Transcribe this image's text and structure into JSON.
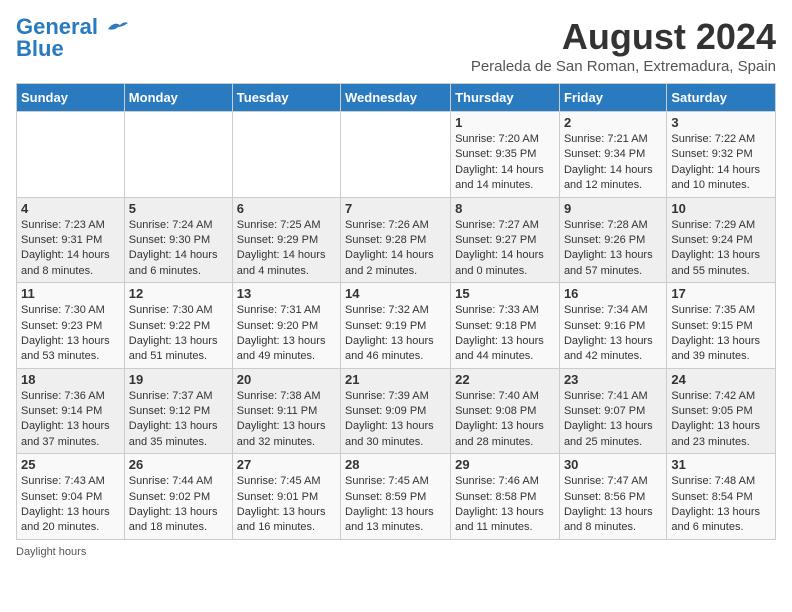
{
  "header": {
    "logo_line1": "General",
    "logo_line2": "Blue",
    "month_year": "August 2024",
    "location": "Peraleda de San Roman, Extremadura, Spain"
  },
  "days_of_week": [
    "Sunday",
    "Monday",
    "Tuesday",
    "Wednesday",
    "Thursday",
    "Friday",
    "Saturday"
  ],
  "weeks": [
    [
      {
        "day": "",
        "info": ""
      },
      {
        "day": "",
        "info": ""
      },
      {
        "day": "",
        "info": ""
      },
      {
        "day": "",
        "info": ""
      },
      {
        "day": "1",
        "info": "Sunrise: 7:20 AM\nSunset: 9:35 PM\nDaylight: 14 hours\nand 14 minutes."
      },
      {
        "day": "2",
        "info": "Sunrise: 7:21 AM\nSunset: 9:34 PM\nDaylight: 14 hours\nand 12 minutes."
      },
      {
        "day": "3",
        "info": "Sunrise: 7:22 AM\nSunset: 9:32 PM\nDaylight: 14 hours\nand 10 minutes."
      }
    ],
    [
      {
        "day": "4",
        "info": "Sunrise: 7:23 AM\nSunset: 9:31 PM\nDaylight: 14 hours\nand 8 minutes."
      },
      {
        "day": "5",
        "info": "Sunrise: 7:24 AM\nSunset: 9:30 PM\nDaylight: 14 hours\nand 6 minutes."
      },
      {
        "day": "6",
        "info": "Sunrise: 7:25 AM\nSunset: 9:29 PM\nDaylight: 14 hours\nand 4 minutes."
      },
      {
        "day": "7",
        "info": "Sunrise: 7:26 AM\nSunset: 9:28 PM\nDaylight: 14 hours\nand 2 minutes."
      },
      {
        "day": "8",
        "info": "Sunrise: 7:27 AM\nSunset: 9:27 PM\nDaylight: 14 hours\nand 0 minutes."
      },
      {
        "day": "9",
        "info": "Sunrise: 7:28 AM\nSunset: 9:26 PM\nDaylight: 13 hours\nand 57 minutes."
      },
      {
        "day": "10",
        "info": "Sunrise: 7:29 AM\nSunset: 9:24 PM\nDaylight: 13 hours\nand 55 minutes."
      }
    ],
    [
      {
        "day": "11",
        "info": "Sunrise: 7:30 AM\nSunset: 9:23 PM\nDaylight: 13 hours\nand 53 minutes."
      },
      {
        "day": "12",
        "info": "Sunrise: 7:30 AM\nSunset: 9:22 PM\nDaylight: 13 hours\nand 51 minutes."
      },
      {
        "day": "13",
        "info": "Sunrise: 7:31 AM\nSunset: 9:20 PM\nDaylight: 13 hours\nand 49 minutes."
      },
      {
        "day": "14",
        "info": "Sunrise: 7:32 AM\nSunset: 9:19 PM\nDaylight: 13 hours\nand 46 minutes."
      },
      {
        "day": "15",
        "info": "Sunrise: 7:33 AM\nSunset: 9:18 PM\nDaylight: 13 hours\nand 44 minutes."
      },
      {
        "day": "16",
        "info": "Sunrise: 7:34 AM\nSunset: 9:16 PM\nDaylight: 13 hours\nand 42 minutes."
      },
      {
        "day": "17",
        "info": "Sunrise: 7:35 AM\nSunset: 9:15 PM\nDaylight: 13 hours\nand 39 minutes."
      }
    ],
    [
      {
        "day": "18",
        "info": "Sunrise: 7:36 AM\nSunset: 9:14 PM\nDaylight: 13 hours\nand 37 minutes."
      },
      {
        "day": "19",
        "info": "Sunrise: 7:37 AM\nSunset: 9:12 PM\nDaylight: 13 hours\nand 35 minutes."
      },
      {
        "day": "20",
        "info": "Sunrise: 7:38 AM\nSunset: 9:11 PM\nDaylight: 13 hours\nand 32 minutes."
      },
      {
        "day": "21",
        "info": "Sunrise: 7:39 AM\nSunset: 9:09 PM\nDaylight: 13 hours\nand 30 minutes."
      },
      {
        "day": "22",
        "info": "Sunrise: 7:40 AM\nSunset: 9:08 PM\nDaylight: 13 hours\nand 28 minutes."
      },
      {
        "day": "23",
        "info": "Sunrise: 7:41 AM\nSunset: 9:07 PM\nDaylight: 13 hours\nand 25 minutes."
      },
      {
        "day": "24",
        "info": "Sunrise: 7:42 AM\nSunset: 9:05 PM\nDaylight: 13 hours\nand 23 minutes."
      }
    ],
    [
      {
        "day": "25",
        "info": "Sunrise: 7:43 AM\nSunset: 9:04 PM\nDaylight: 13 hours\nand 20 minutes."
      },
      {
        "day": "26",
        "info": "Sunrise: 7:44 AM\nSunset: 9:02 PM\nDaylight: 13 hours\nand 18 minutes."
      },
      {
        "day": "27",
        "info": "Sunrise: 7:45 AM\nSunset: 9:01 PM\nDaylight: 13 hours\nand 16 minutes."
      },
      {
        "day": "28",
        "info": "Sunrise: 7:45 AM\nSunset: 8:59 PM\nDaylight: 13 hours\nand 13 minutes."
      },
      {
        "day": "29",
        "info": "Sunrise: 7:46 AM\nSunset: 8:58 PM\nDaylight: 13 hours\nand 11 minutes."
      },
      {
        "day": "30",
        "info": "Sunrise: 7:47 AM\nSunset: 8:56 PM\nDaylight: 13 hours\nand 8 minutes."
      },
      {
        "day": "31",
        "info": "Sunrise: 7:48 AM\nSunset: 8:54 PM\nDaylight: 13 hours\nand 6 minutes."
      }
    ]
  ],
  "footer": {
    "daylight_label": "Daylight hours"
  }
}
